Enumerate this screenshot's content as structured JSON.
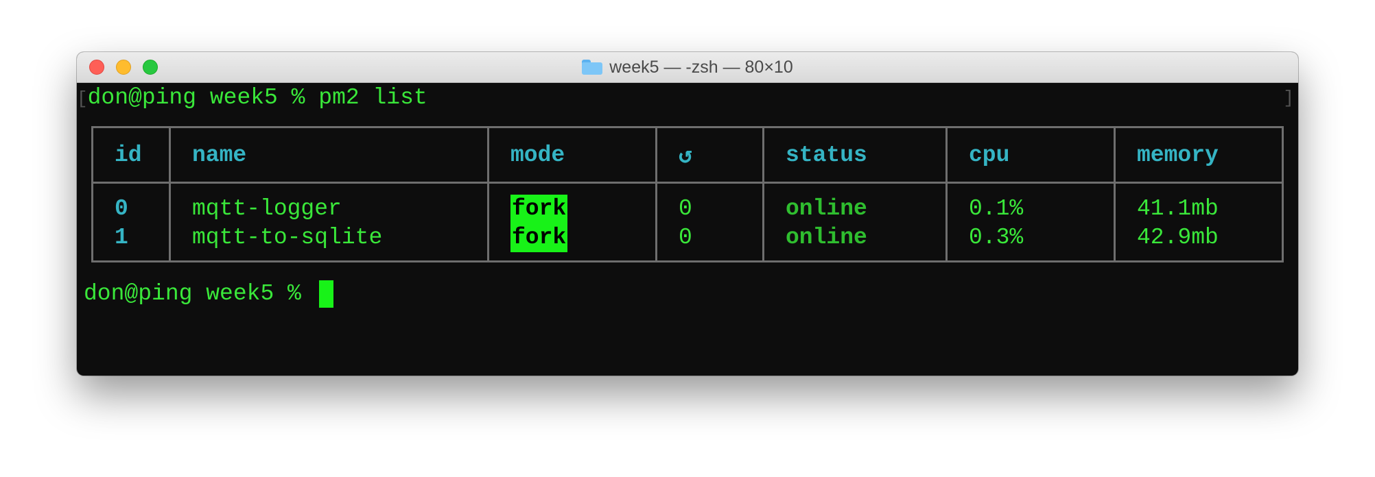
{
  "window": {
    "title": "week5 — -zsh — 80×10"
  },
  "terminal": {
    "command_line": "don@ping week5 % pm2 list",
    "prompt": "don@ping week5 % ",
    "bracket_left": "[",
    "bracket_right": "]",
    "colors": {
      "foreground": "#3ae83a",
      "header": "#35b4c4",
      "mode_highlight": "#18f218",
      "background": "#0d0d0d"
    }
  },
  "table": {
    "headers": {
      "id": "id",
      "name": "name",
      "mode": "mode",
      "restarts": "↺",
      "status": "status",
      "cpu": "cpu",
      "memory": "memory"
    },
    "rows": [
      {
        "id": "0",
        "name": "mqtt-logger",
        "mode": "fork",
        "restarts": "0",
        "status": "online",
        "cpu": "0.1%",
        "memory": "41.1mb"
      },
      {
        "id": "1",
        "name": "mqtt-to-sqlite",
        "mode": "fork",
        "restarts": "0",
        "status": "online",
        "cpu": "0.3%",
        "memory": "42.9mb"
      }
    ]
  },
  "icons": {
    "folder": "folder-icon",
    "close": "close-icon",
    "minimize": "minimize-icon",
    "zoom": "zoom-icon",
    "restart": "restart-icon"
  }
}
